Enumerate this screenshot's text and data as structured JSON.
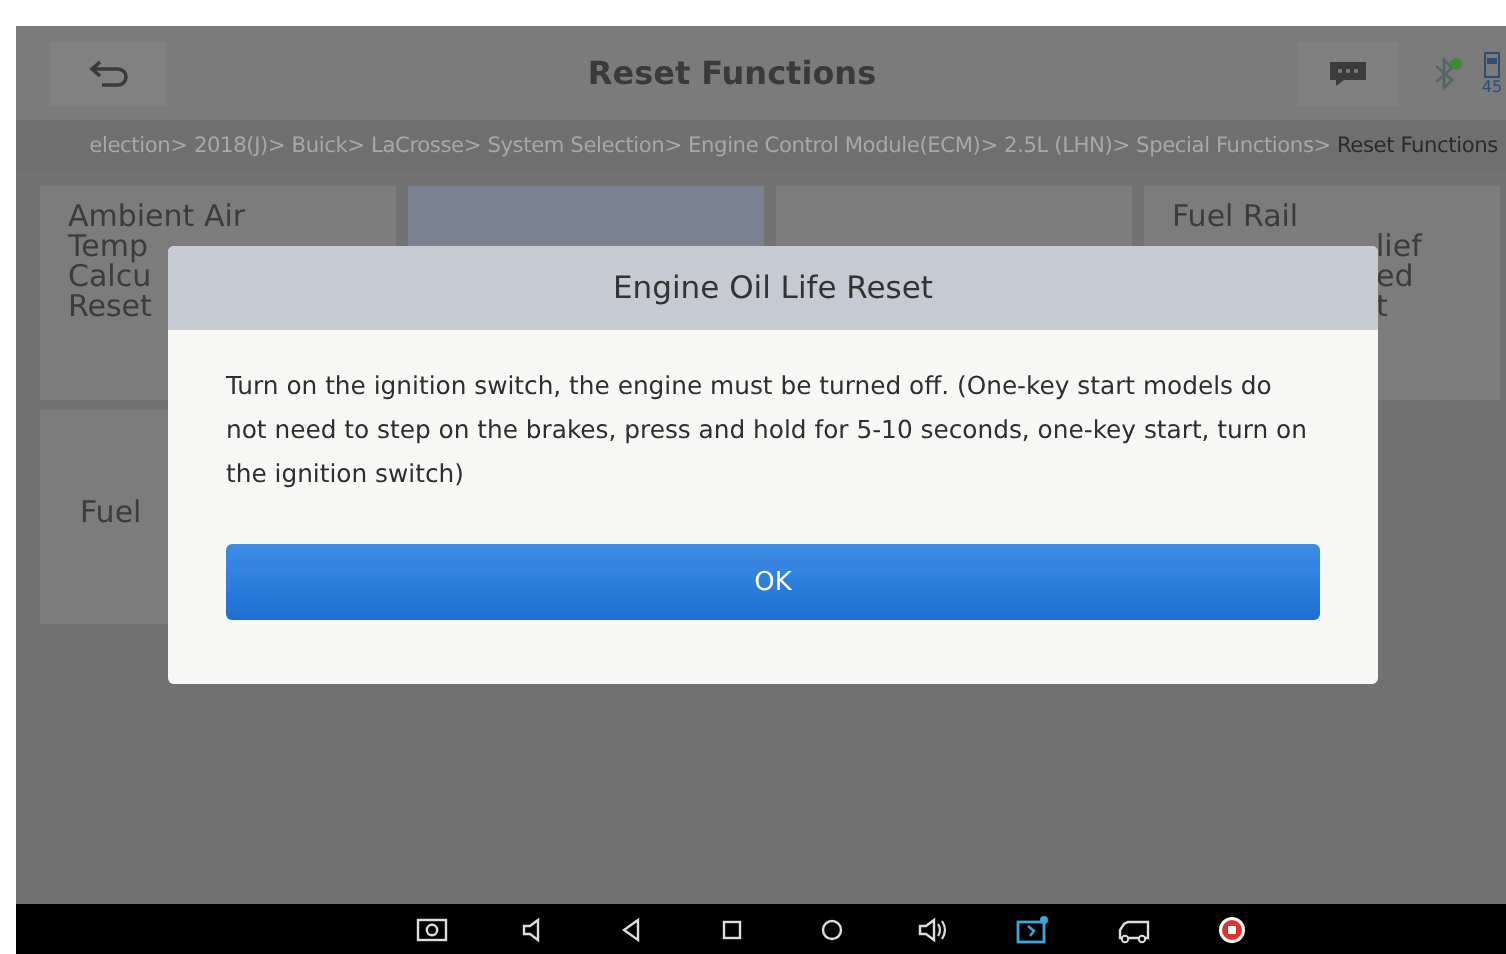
{
  "header": {
    "title": "Reset Functions",
    "battery": "45"
  },
  "breadcrumb": [
    {
      "text": "election> 2018(J)> Buick> LaCrosse> System Selection> Engine Control Module(ECM)> 2.5L (LHN)> Special Functions>",
      "current": false
    },
    {
      "text": "Reset Functions",
      "current": true
    }
  ],
  "tiles": [
    {
      "lines": [
        "Ambient Air",
        "Temp",
        "Calcu",
        "Reset"
      ],
      "selected": false
    },
    {
      "selected": true
    },
    {
      "selected": false
    },
    {
      "lines": [
        "Fuel Rail",
        "lief",
        "ed",
        "t"
      ],
      "selected": false
    },
    {
      "lines": [
        "Fuel"
      ],
      "selected": false
    }
  ],
  "dialog": {
    "title": "Engine Oil Life Reset",
    "message": "Turn on the ignition switch, the engine must be turned off. (One-key start models do not need to step on the brakes, press and hold for 5-10 seconds, one-key start, turn on the ignition switch)",
    "button": "OK"
  },
  "navbar": [
    {
      "kind": "screenshot"
    },
    {
      "kind": "vol-down"
    },
    {
      "kind": "back"
    },
    {
      "kind": "recent"
    },
    {
      "kind": "home"
    },
    {
      "kind": "vol-up"
    },
    {
      "kind": "vci"
    },
    {
      "kind": "truck"
    },
    {
      "kind": "record"
    }
  ]
}
